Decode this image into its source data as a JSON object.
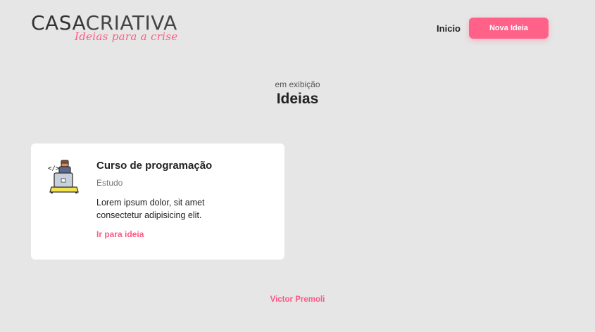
{
  "header": {
    "logo_bold": "CASA",
    "logo_thin": "CRIATIVA",
    "logo_tagline": "Ideias para a crise",
    "nav_home": "Inicio",
    "nav_new_idea": "Nova Ideia"
  },
  "heading": {
    "subtitle": "em exibição",
    "title": "Ideias"
  },
  "ideas": [
    {
      "icon": "programmer-icon",
      "title": "Curso de programação",
      "category": "Estudo",
      "description": "Lorem ipsum dolor, sit amet consectetur adipisicing elit.",
      "link": "Ir para ideia"
    }
  ],
  "footer": {
    "author": "Victor Premoli"
  },
  "colors": {
    "accent": "#ff6189",
    "background": "#e6e6e6",
    "card": "#ffffff"
  }
}
